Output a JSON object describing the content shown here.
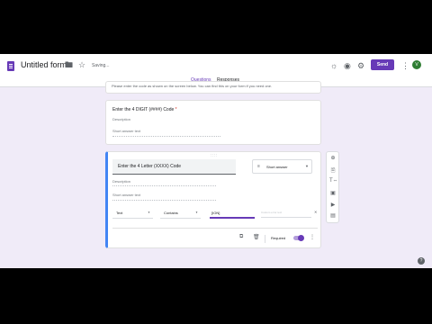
{
  "header": {
    "title": "Untitled form",
    "saving_status": "Saving...",
    "send_label": "Send",
    "avatar_letter": "V",
    "icons": [
      "form-icon",
      "folder-icon",
      "star-icon",
      "palette-icon",
      "preview-icon",
      "settings-icon",
      "more-icon"
    ]
  },
  "tabs": [
    {
      "label": "Questions",
      "active": true
    },
    {
      "label": "Responses",
      "active": false
    }
  ],
  "top_card_text": "Please enter the code as shown on the screen below. You can find this on your form if you need one.",
  "question1": {
    "title": "Enter the 4 DIGIT (####) Code",
    "required_mark": "*",
    "description_label": "Description",
    "answer_placeholder": "Short answer text"
  },
  "question2": {
    "title": "Enter the 4 Letter (XXXX) Code",
    "type_label": "Short answer",
    "description_label": "Description",
    "answer_placeholder": "Short answer text",
    "validation": {
      "type": "Text",
      "condition": "Contains",
      "value": "[ION]",
      "error_placeholder": "Custom error text"
    },
    "required_label": "Required",
    "required_on": true
  },
  "colors": {
    "accent": "#673ab7",
    "background": "#f0ebf8",
    "active_border": "#4285f4"
  }
}
